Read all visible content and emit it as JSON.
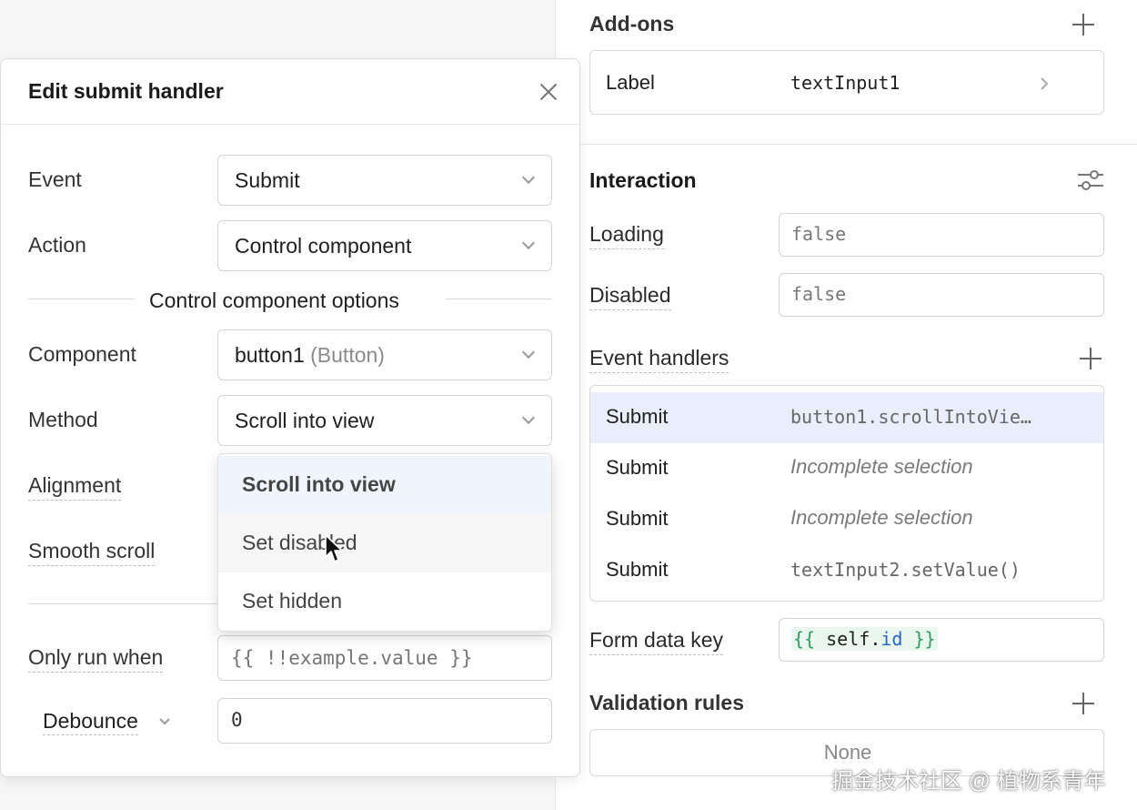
{
  "inspector": {
    "addons": {
      "title": "Add-ons",
      "row_key": "Label",
      "row_value": "textInput1"
    },
    "interaction": {
      "title": "Interaction",
      "loading_label": "Loading",
      "loading_value": "false",
      "disabled_label": "Disabled",
      "disabled_value": "false"
    },
    "event_handlers": {
      "title": "Event handlers",
      "rows": [
        {
          "event": "Submit",
          "action": "button1.scrollIntoVie…"
        },
        {
          "event": "Submit",
          "action": "Incomplete selection"
        },
        {
          "event": "Submit",
          "action": "Incomplete selection"
        },
        {
          "event": "Submit",
          "action": "textInput2.setValue()"
        }
      ]
    },
    "form_data_key": {
      "label": "Form data key",
      "open": "{{",
      "self": "self",
      "dot": ".",
      "prop": "id",
      "close": "}}"
    },
    "validation": {
      "title": "Validation rules",
      "value": "None"
    }
  },
  "modal": {
    "title": "Edit submit handler",
    "event_label": "Event",
    "event_value": "Submit",
    "action_label": "Action",
    "action_value": "Control component",
    "divider": "Control component options",
    "component_label": "Component",
    "component_value": "button1",
    "component_type": "(Button)",
    "method_label": "Method",
    "method_value": "Scroll into view",
    "alignment_label": "Alignment",
    "smooth_label": "Smooth scroll",
    "only_run_label": "Only run when",
    "only_run_placeholder": "{{ !!example.value }}",
    "debounce_label": "Debounce",
    "debounce_value": "0",
    "dropdown_options": [
      "Scroll into view",
      "Set disabled",
      "Set hidden"
    ]
  },
  "watermark": "掘金技术社区 @ 植物系青年",
  "colors": {
    "selected_row": "#e8eefb",
    "code_green": "#2f9e5e",
    "code_blue": "#2563c9",
    "code_bg": "#e9f7ee"
  }
}
